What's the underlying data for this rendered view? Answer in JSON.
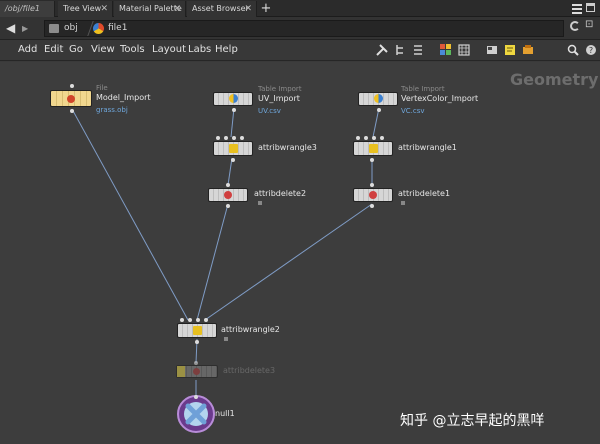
{
  "tabs": {
    "items": [
      {
        "label": "/obj/file1"
      },
      {
        "label": "Tree View"
      },
      {
        "label": "Material Palette"
      },
      {
        "label": "Asset Browser"
      }
    ],
    "add": "+"
  },
  "path": {
    "back": "◀",
    "forward": "▶",
    "obj": "obj",
    "file": "file1"
  },
  "menu": {
    "items": [
      "Add",
      "Edit",
      "Go",
      "View",
      "Tools",
      "Layout",
      "Labs",
      "Help"
    ]
  },
  "network": {
    "context_label": "Geometry",
    "nodes": {
      "model_import": {
        "category": "File",
        "name": "Model_Import",
        "detail": "grass.obj"
      },
      "uv_import": {
        "category": "Table Import",
        "name": "UV_Import",
        "detail": "UV.csv"
      },
      "vc_import": {
        "category": "Table Import",
        "name": "VertexColor_Import",
        "detail": "VC.csv"
      },
      "attribwrangle3": {
        "name": "attribwrangle3"
      },
      "attribwrangle1": {
        "name": "attribwrangle1"
      },
      "attribdelete2": {
        "name": "attribdelete2"
      },
      "attribdelete1": {
        "name": "attribdelete1"
      },
      "attribwrangle2": {
        "name": "attribwrangle2"
      },
      "attribdelete3": {
        "name": "attribdelete3"
      },
      "null1": {
        "name": "null1"
      }
    }
  },
  "watermark": "知乎 @立志早起的黑咩",
  "colors": {
    "wire": "#7f9cc6",
    "bypassed_flag": "#e8d64a",
    "detail_text": "#6fa7dc",
    "network_bg": "#3d3d3d"
  },
  "icons": [
    "back-arrow-icon",
    "forward-arrow-icon",
    "obj-icon",
    "geo-icon",
    "pin-icon",
    "link-icon",
    "tools-icon",
    "grid-icon",
    "palette-icon",
    "note-icon",
    "sticky-icon",
    "dashboard-icon",
    "search-icon",
    "help-icon"
  ]
}
